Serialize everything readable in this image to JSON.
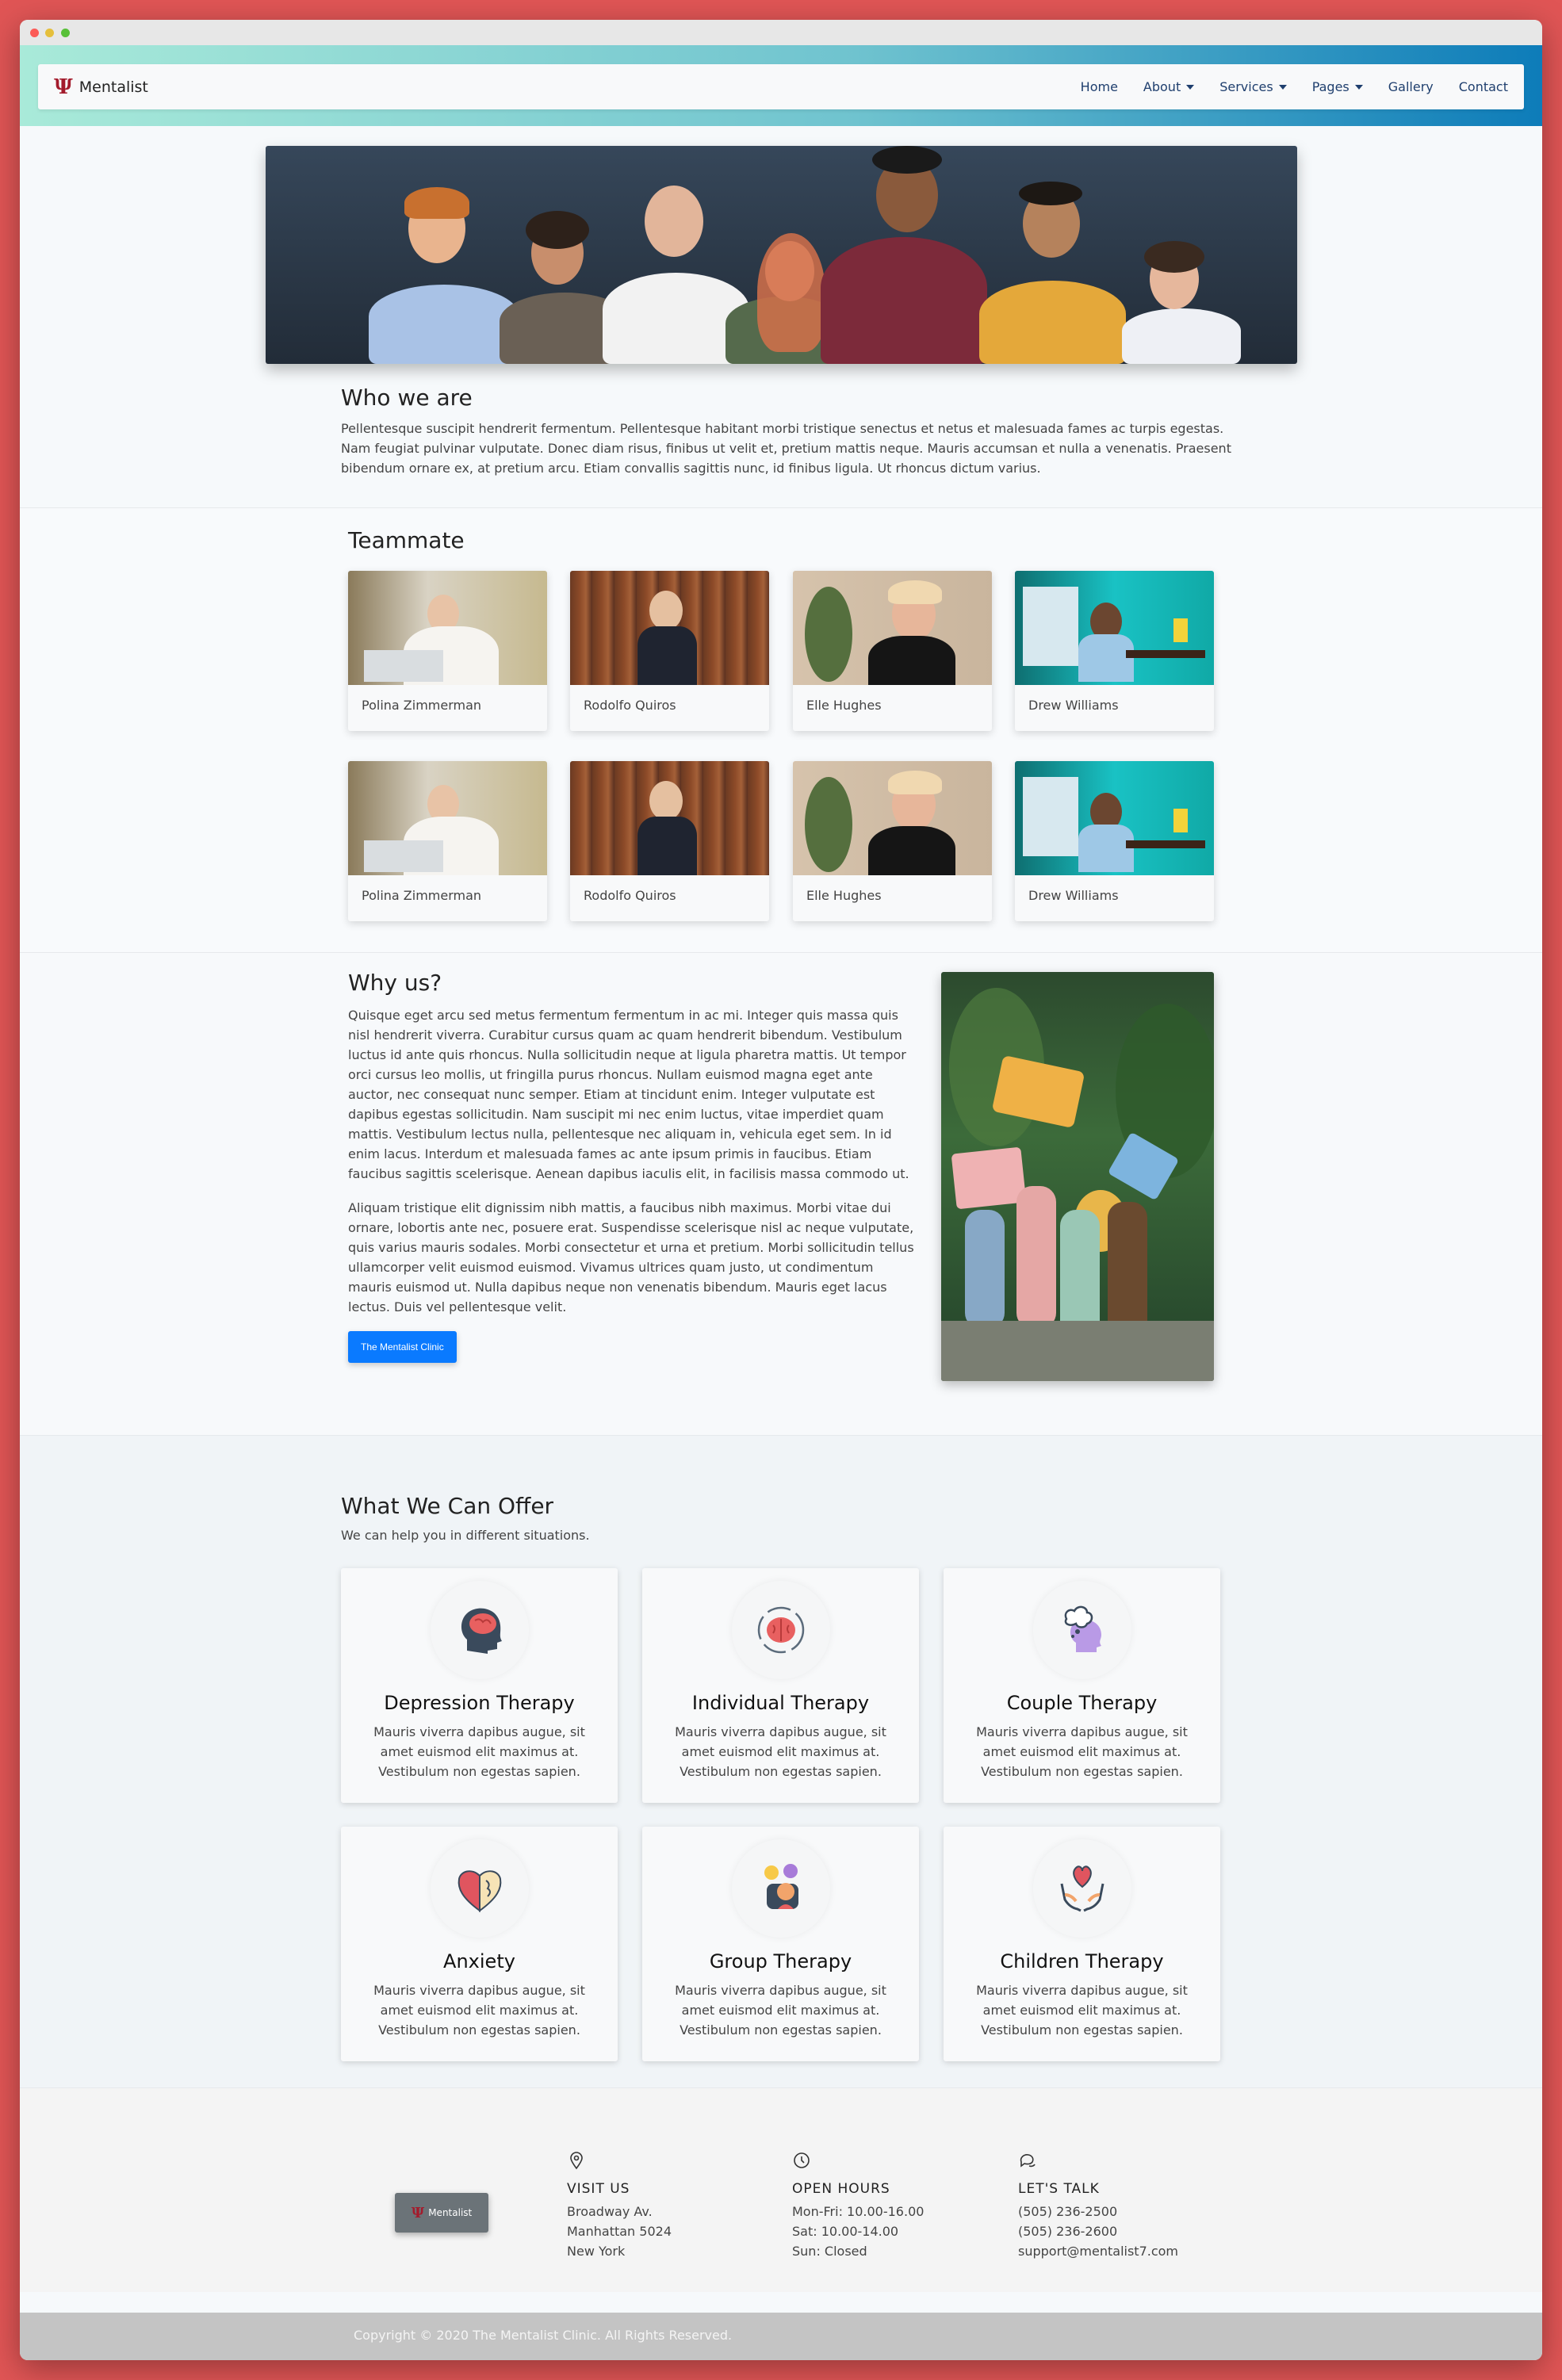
{
  "nav": {
    "brand": "Mentalist",
    "brand_symbol": "Ψ",
    "items": [
      {
        "label": "Home",
        "dropdown": false
      },
      {
        "label": "About",
        "dropdown": true
      },
      {
        "label": "Services",
        "dropdown": true
      },
      {
        "label": "Pages",
        "dropdown": true
      },
      {
        "label": "Gallery",
        "dropdown": false
      },
      {
        "label": "Contact",
        "dropdown": false
      }
    ]
  },
  "who": {
    "title": "Who we are",
    "text": "Pellentesque suscipit hendrerit fermentum. Pellentesque habitant morbi tristique senectus et netus et malesuada fames ac turpis egestas. Nam feugiat pulvinar vulputate. Donec diam risus, finibus ut velit et, pretium mattis neque. Mauris accumsan et nulla a venenatis. Praesent bibendum ornare ex, at pretium arcu. Etiam convallis sagittis nunc, id finibus ligula. Ut rhoncus dictum varius."
  },
  "team": {
    "title": "Teammate",
    "members": [
      {
        "name": "Polina Zimmerman"
      },
      {
        "name": "Rodolfo Quiros"
      },
      {
        "name": "Elle Hughes"
      },
      {
        "name": "Drew Williams"
      },
      {
        "name": "Polina Zimmerman"
      },
      {
        "name": "Rodolfo Quiros"
      },
      {
        "name": "Elle Hughes"
      },
      {
        "name": "Drew Williams"
      }
    ]
  },
  "why": {
    "title": "Why us?",
    "p1": "Quisque eget arcu sed metus fermentum fermentum in ac mi. Integer quis massa quis nisl hendrerit viverra. Curabitur cursus quam ac quam hendrerit bibendum. Vestibulum luctus id ante quis rhoncus. Nulla sollicitudin neque at ligula pharetra mattis. Ut tempor orci cursus leo mollis, ut fringilla purus rhoncus. Nullam euismod magna eget ante auctor, nec consequat nunc semper. Etiam at tincidunt enim. Integer vulputate est dapibus egestas sollicitudin. Nam suscipit mi nec enim luctus, vitae imperdiet quam mattis. Vestibulum lectus nulla, pellentesque nec aliquam in, vehicula eget sem. In id enim lacus. Interdum et malesuada fames ac ante ipsum primis in faucibus. Etiam faucibus sagittis scelerisque. Aenean dapibus iaculis elit, in facilisis massa commodo ut.",
    "p2": "Aliquam tristique elit dignissim nibh mattis, a faucibus nibh maximus. Morbi vitae dui ornare, lobortis ante nec, posuere erat. Suspendisse scelerisque nisl ac neque vulputate, quis varius mauris sodales. Morbi consectetur et urna et pretium. Morbi sollicitudin tellus ullamcorper velit euismod euismod. Vivamus ultrices quam justo, ut condimentum mauris euismod ut. Nulla dapibus neque non venenatis bibendum. Mauris eget lacus lectus. Duis vel pellentesque velit.",
    "button": "The Mentalist Clinic"
  },
  "offer": {
    "title": "What We Can Offer",
    "subtitle": "We can help you in different situations.",
    "services": [
      {
        "title": "Depression Therapy",
        "icon": "head-brain-icon",
        "text": "Mauris viverra dapibus augue, sit amet euismod elit maximus at. Vestibulum non egestas sapien."
      },
      {
        "title": "Individual Therapy",
        "icon": "brain-cycle-icon",
        "text": "Mauris viverra dapibus augue, sit amet euismod elit maximus at. Vestibulum non egestas sapien."
      },
      {
        "title": "Couple Therapy",
        "icon": "thinking-head-icon",
        "text": "Mauris viverra dapibus augue, sit amet euismod elit maximus at. Vestibulum non egestas sapien."
      },
      {
        "title": "Anxiety",
        "icon": "heart-brain-icon",
        "text": "Mauris viverra dapibus augue, sit amet euismod elit maximus at. Vestibulum non egestas sapien."
      },
      {
        "title": "Group Therapy",
        "icon": "group-faces-icon",
        "text": "Mauris viverra dapibus augue, sit amet euismod elit maximus at. Vestibulum non egestas sapien."
      },
      {
        "title": "Children Therapy",
        "icon": "hands-heart-icon",
        "text": "Mauris viverra dapibus augue, sit amet euismod elit maximus at. Vestibulum non egestas sapien."
      }
    ]
  },
  "footer": {
    "logo": "Mentalist",
    "visit": {
      "title": "VISIT US",
      "lines": [
        "Broadway Av.",
        "Manhattan 5024",
        "New York"
      ]
    },
    "hours": {
      "title": "OPEN HOURS",
      "lines": [
        "Mon-Fri: 10.00-16.00",
        "Sat: 10.00-14.00",
        "Sun: Closed"
      ]
    },
    "talk": {
      "title": "LET'S TALK",
      "lines": [
        "(505) 236-2500",
        "(505) 236-2600",
        "support@mentalist7.com"
      ]
    },
    "copyright": "Copyright © 2020 The Mentalist Clinic. All Rights Reserved."
  },
  "colors": {
    "accent": "#0a7aff",
    "brand": "#a31b2c",
    "background": "#e05555"
  }
}
